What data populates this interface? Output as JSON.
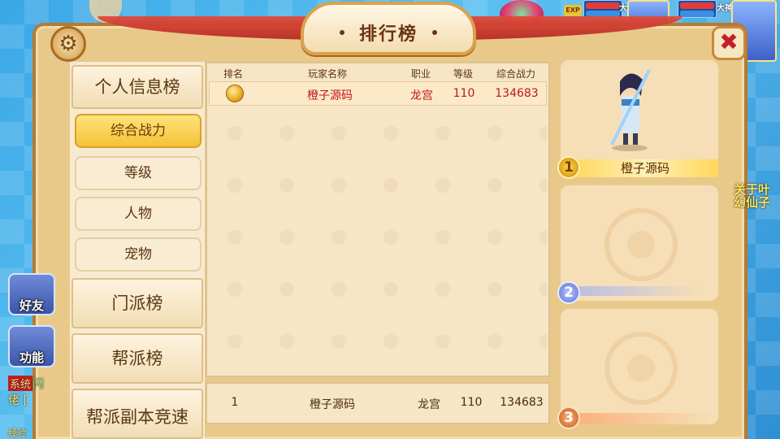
{
  "window": {
    "title": "排行榜"
  },
  "hud": {
    "exp_label": "EXP",
    "player1_name": "大神",
    "player2_name": "大神"
  },
  "menu": {
    "items": [
      {
        "label": "个人信息榜",
        "type": "big"
      },
      {
        "label": "综合战力",
        "type": "small",
        "active": true
      },
      {
        "label": "等级",
        "type": "small"
      },
      {
        "label": "人物",
        "type": "small"
      },
      {
        "label": "宠物",
        "type": "small"
      },
      {
        "label": "门派榜",
        "type": "big"
      },
      {
        "label": "帮派榜",
        "type": "big"
      },
      {
        "label": "帮派副本竞速",
        "type": "big"
      }
    ]
  },
  "table": {
    "columns": [
      "排名",
      "玩家名称",
      "职业",
      "等级",
      "综合战力"
    ],
    "rows": [
      {
        "rank": "1",
        "name": "橙子源码",
        "class": "龙宫",
        "level": "110",
        "power": "134683"
      }
    ]
  },
  "my_rank": {
    "rank": "1",
    "name": "橙子源码",
    "class": "龙宫",
    "level": "110",
    "power": "134683"
  },
  "podium": {
    "first": {
      "rank": "1",
      "name": "橙子源码"
    },
    "second": {
      "rank": "2"
    },
    "third": {
      "rank": "3"
    }
  },
  "side": {
    "friends_label": "好友",
    "functions_label": "功能",
    "chat_tag": "系统",
    "chat_text_1": "闪",
    "chat_text_2": "佬 [",
    "chat_text_3": "经验"
  },
  "right_edge": {
    "text_1": "关于叶",
    "text_2": "幻仙子"
  },
  "colors": {
    "accent_red": "#c0161a",
    "panel": "#e9c98a",
    "active_tab": "#f5c236"
  }
}
